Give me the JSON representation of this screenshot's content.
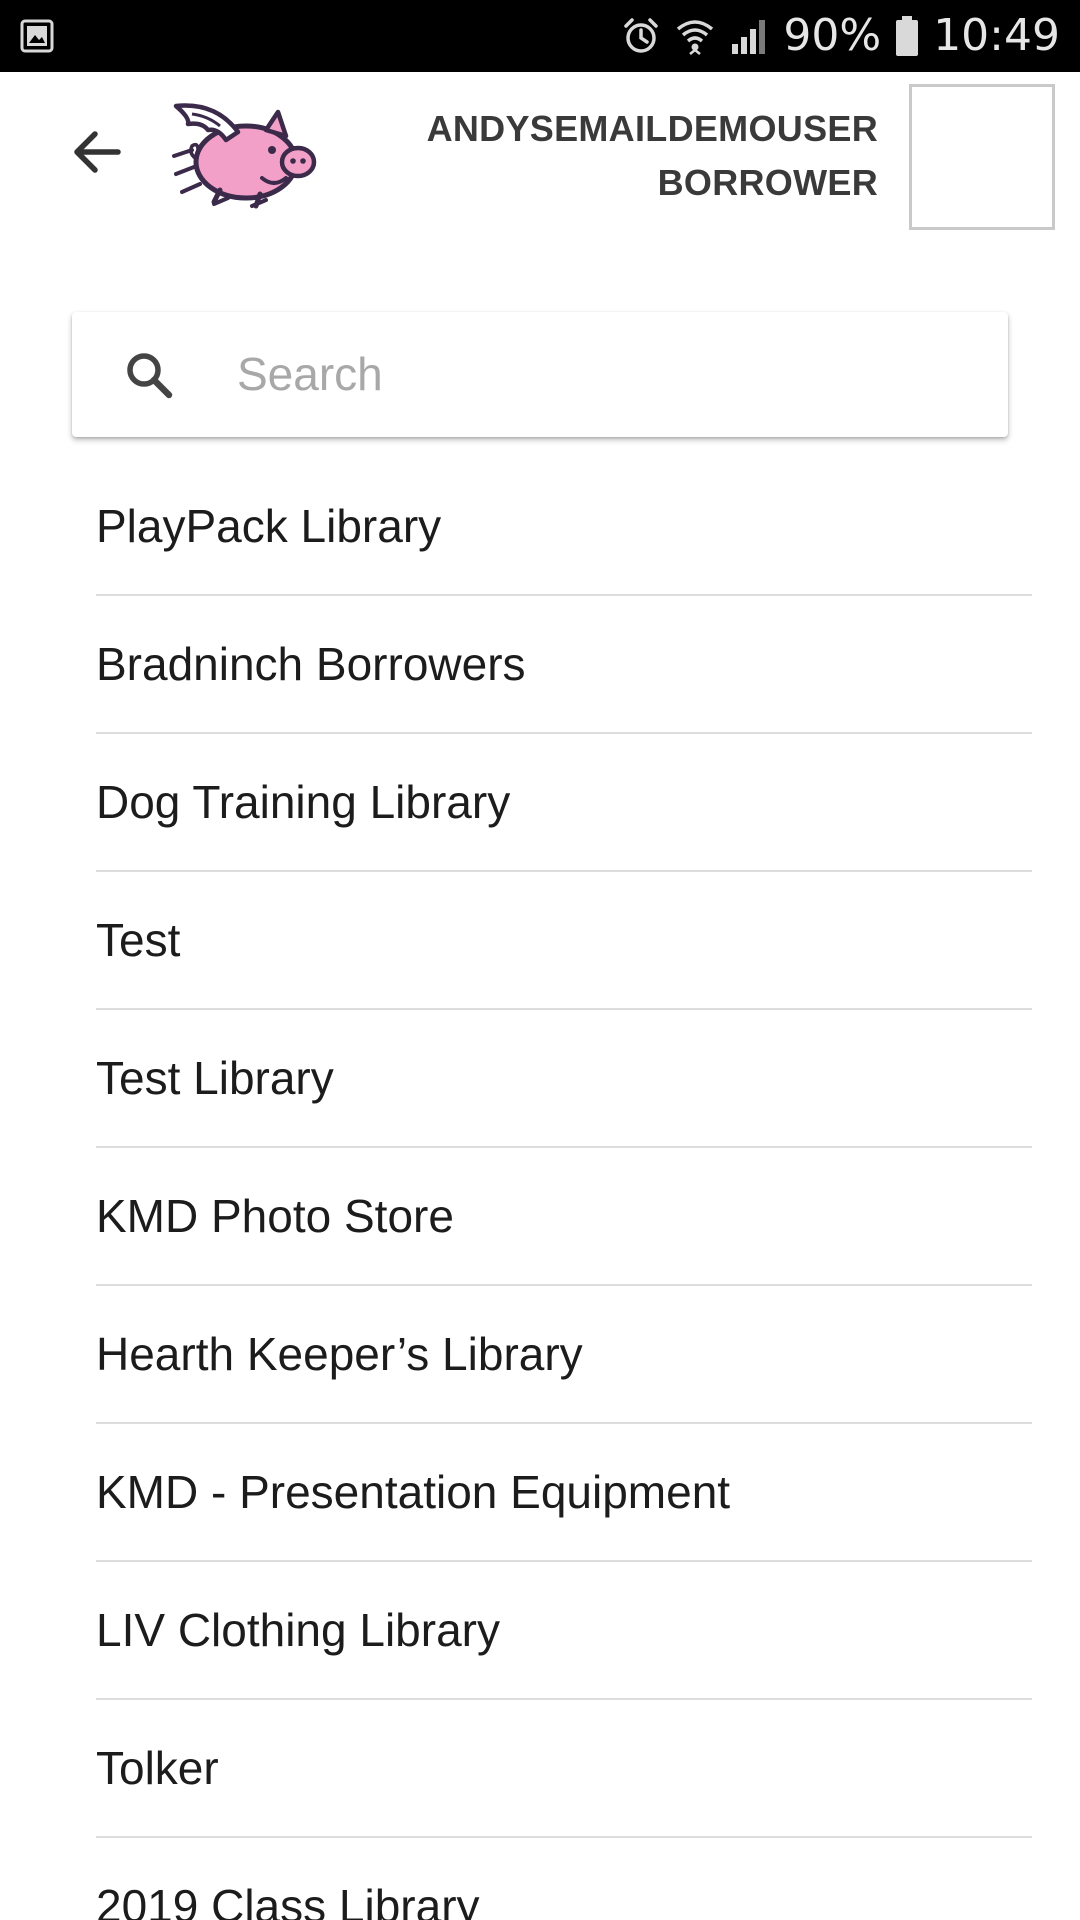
{
  "status_bar": {
    "battery_percent": "90%",
    "time": "10:49",
    "icons": [
      "gallery-notification-icon",
      "alarm-icon",
      "wifi-icon",
      "signal-icon",
      "battery-icon"
    ]
  },
  "header": {
    "back_icon": "arrow-back-icon",
    "logo": "flying-pig-logo",
    "user_name": "ANDYSEMAILDEMOUSER",
    "user_role": "BORROWER"
  },
  "search": {
    "icon": "search-icon",
    "placeholder": "Search",
    "value": ""
  },
  "libraries": [
    {
      "label": "PlayPack Library"
    },
    {
      "label": "Bradninch Borrowers"
    },
    {
      "label": "Dog Training Library"
    },
    {
      "label": "Test"
    },
    {
      "label": "Test Library"
    },
    {
      "label": "KMD Photo Store"
    },
    {
      "label": "Hearth Keeper’s Library"
    },
    {
      "label": "KMD - Presentation Equipment"
    },
    {
      "label": "LIV Clothing Library"
    },
    {
      "label": "Tolker"
    },
    {
      "label": "2019 Class Library"
    }
  ],
  "colors": {
    "status_bar_bg": "#000000",
    "logo_pink": "#f3a0c8",
    "logo_outline": "#3b2a4a",
    "divider": "#dddddd",
    "placeholder": "#a8a8a8"
  }
}
